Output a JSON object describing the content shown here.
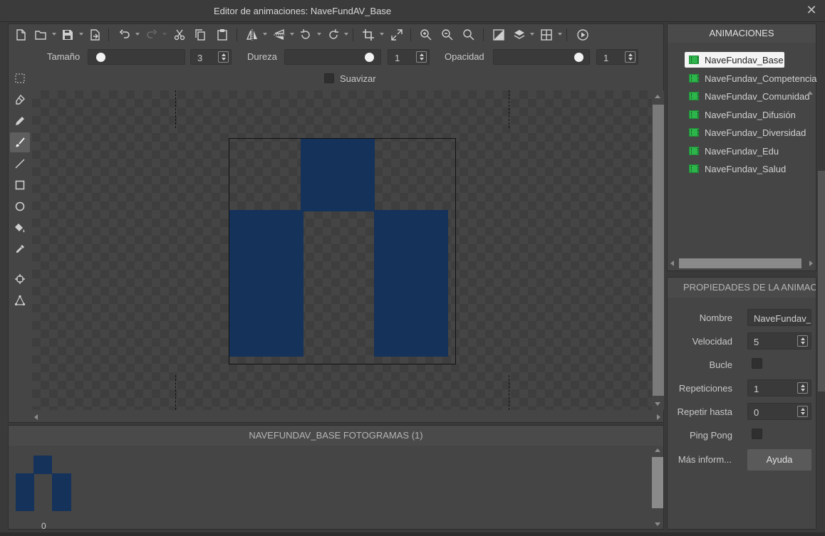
{
  "window": {
    "title": "Editor de animaciones: NaveFundAV_Base",
    "close_icon": "close-icon"
  },
  "toolbar": {
    "buttons": [
      "new-file-icon",
      "open-folder-icon",
      "save-icon",
      "export-icon",
      "undo-icon",
      "redo-icon",
      "cut-icon",
      "copy-icon",
      "paste-icon",
      "flip-horizontal-icon",
      "flip-vertical-icon",
      "rotate-left-icon",
      "rotate-right-icon",
      "crop-icon",
      "resize-icon",
      "zoom-in-icon",
      "zoom-out-icon",
      "zoom-fit-icon",
      "background-icon",
      "layers-icon",
      "grid-icon",
      "play-icon"
    ]
  },
  "options": {
    "size_label": "Tamaño",
    "size_value": "3",
    "hardness_label": "Dureza",
    "hardness_value": "1",
    "opacity_label": "Opacidad",
    "opacity_value": "1",
    "smooth_label": "Suavizar"
  },
  "tools": [
    "select-icon",
    "eraser-icon",
    "pencil-icon",
    "brush-icon",
    "line-icon",
    "rectangle-icon",
    "ellipse-icon",
    "fill-icon",
    "eyedropper-icon",
    "origin-icon",
    "mask-icon"
  ],
  "active_tool": "brush-icon",
  "sprite_color": "#14325a",
  "frames": {
    "header": "NAVEFUNDAV_BASE FOTOGRAMAS (1)",
    "items": [
      {
        "label": "0"
      }
    ]
  },
  "animations": {
    "header": "ANIMACIONES",
    "items": [
      {
        "label": "NaveFundav_Base",
        "selected": true
      },
      {
        "label": "NaveFundav_Competencia"
      },
      {
        "label": "NaveFundav_Comunidad"
      },
      {
        "label": "NaveFundav_Difusión"
      },
      {
        "label": "NaveFundav_Diversidad"
      },
      {
        "label": "NaveFundav_Edu"
      },
      {
        "label": "NaveFundav_Salud"
      }
    ]
  },
  "properties": {
    "header": "PROPIEDADES DE LA ANIMACIÓ",
    "name_label": "Nombre",
    "name_value": "NaveFundav_",
    "speed_label": "Velocidad",
    "speed_value": "5",
    "loop_label": "Bucle",
    "repeats_label": "Repeticiones",
    "repeats_value": "1",
    "repeat_until_label": "Repetir hasta",
    "repeat_until_value": "0",
    "pingpong_label": "Ping Pong",
    "more_label": "Más inform...",
    "help_button": "Ayuda"
  }
}
